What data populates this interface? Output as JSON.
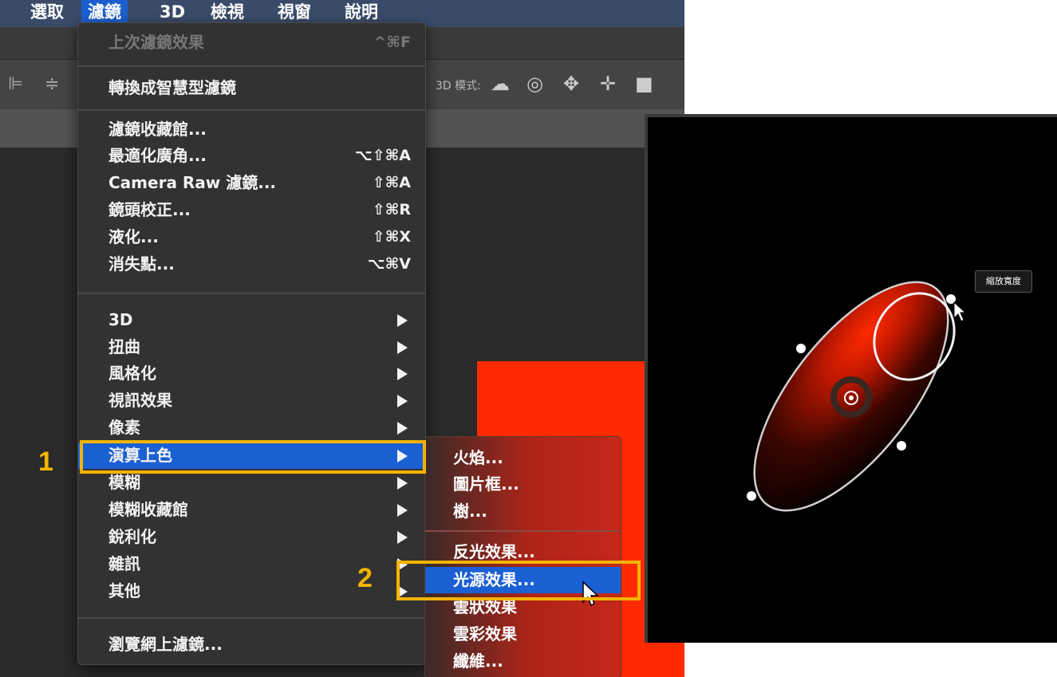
{
  "menubar": {
    "items": [
      {
        "label": "選取"
      },
      {
        "label": "濾鏡"
      },
      {
        "label": "3D"
      },
      {
        "label": "檢視"
      },
      {
        "label": "視窗"
      },
      {
        "label": "說明"
      }
    ],
    "active_index": 1
  },
  "optionsbar": {
    "mode_label": "3D 模式:"
  },
  "filter_menu": {
    "last_filter": {
      "label": "上次濾鏡效果",
      "shortcut": "^⌘F"
    },
    "convert_smart": {
      "label": "轉換成智慧型濾鏡"
    },
    "group1": [
      {
        "label": "濾鏡收藏館...",
        "shortcut": ""
      },
      {
        "label": "最適化廣角...",
        "shortcut": "⌥⇧⌘A"
      },
      {
        "label": "Camera Raw 濾鏡...",
        "shortcut": "⇧⌘A"
      },
      {
        "label": "鏡頭校正...",
        "shortcut": "⇧⌘R"
      },
      {
        "label": "液化...",
        "shortcut": "⇧⌘X"
      },
      {
        "label": "消失點...",
        "shortcut": "⌥⌘V"
      }
    ],
    "group2": [
      {
        "label": "3D"
      },
      {
        "label": "扭曲"
      },
      {
        "label": "風格化"
      },
      {
        "label": "視訊效果"
      },
      {
        "label": "像素"
      },
      {
        "label": "演算上色"
      },
      {
        "label": "模糊"
      },
      {
        "label": "模糊收藏館"
      },
      {
        "label": "銳利化"
      },
      {
        "label": "雜訊"
      },
      {
        "label": "其他"
      }
    ],
    "browse_online": {
      "label": "瀏覽網上濾鏡..."
    }
  },
  "render_submenu": {
    "group1": [
      {
        "label": "火焰..."
      },
      {
        "label": "圖片框..."
      },
      {
        "label": "樹..."
      }
    ],
    "group2": [
      {
        "label": "反光效果..."
      },
      {
        "label": "光源效果..."
      },
      {
        "label": "雲狀效果"
      },
      {
        "label": "雲彩效果"
      },
      {
        "label": "纖維..."
      }
    ]
  },
  "callouts": {
    "step1": "1",
    "step2": "2"
  },
  "light_preview": {
    "tooltip": "縮放寬度"
  },
  "colors": {
    "menubar_bg": "#3a4b6a",
    "highlight_blue": "#1b60d3",
    "callout_yellow": "#f5b400",
    "document_red": "#ff2a00"
  }
}
